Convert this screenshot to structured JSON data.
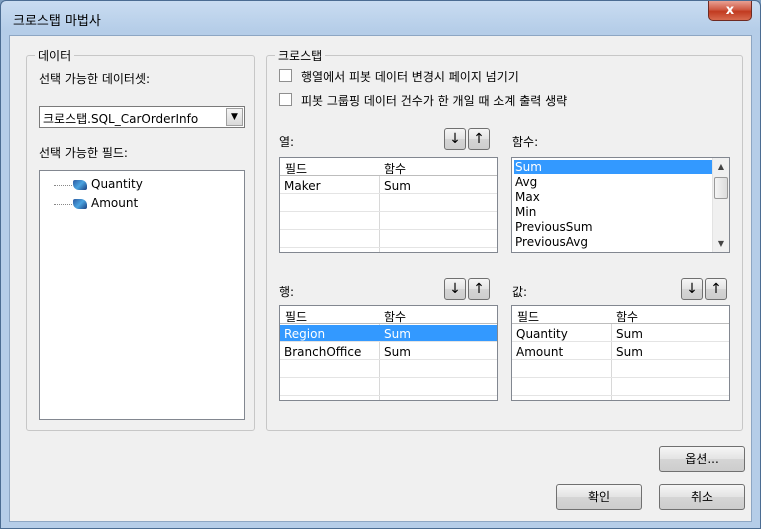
{
  "window": {
    "title": "크로스탭 마법사",
    "close_label": "x"
  },
  "data_group": {
    "title": "데이터",
    "dataset_label": "선택 가능한 데이터셋:",
    "dataset_value": "크로스탭.SQL_CarOrderInfo",
    "fields_label": "선택 가능한 필드:",
    "fields": [
      "Quantity",
      "Amount"
    ]
  },
  "crosstab_group": {
    "title": "크로스탭",
    "option1": "행열에서 피봇 데이터 변경시 페이지 넘기기",
    "option2": "피봇 그룹핑 데이터 건수가 한 개일 때 소계 출력 생략",
    "columns": {
      "label": "열:",
      "headers": [
        "필드",
        "함수"
      ],
      "rows": [
        {
          "field": "Maker",
          "func": "Sum"
        }
      ]
    },
    "functions": {
      "label": "함수:",
      "items": [
        "Sum",
        "Avg",
        "Max",
        "Min",
        "PreviousSum",
        "PreviousAvg"
      ],
      "selected": "Sum"
    },
    "rows": {
      "label": "행:",
      "headers": [
        "필드",
        "함수"
      ],
      "rows": [
        {
          "field": "Region",
          "func": "Sum"
        },
        {
          "field": "BranchOffice",
          "func": "Sum"
        }
      ],
      "selected": "Region"
    },
    "values": {
      "label": "값:",
      "headers": [
        "필드",
        "함수"
      ],
      "rows": [
        {
          "field": "Quantity",
          "func": "Sum"
        },
        {
          "field": "Amount",
          "func": "Sum"
        }
      ]
    },
    "move_down": "↓",
    "move_up": "↑"
  },
  "buttons": {
    "options": "옵션...",
    "ok": "확인",
    "cancel": "취소"
  }
}
